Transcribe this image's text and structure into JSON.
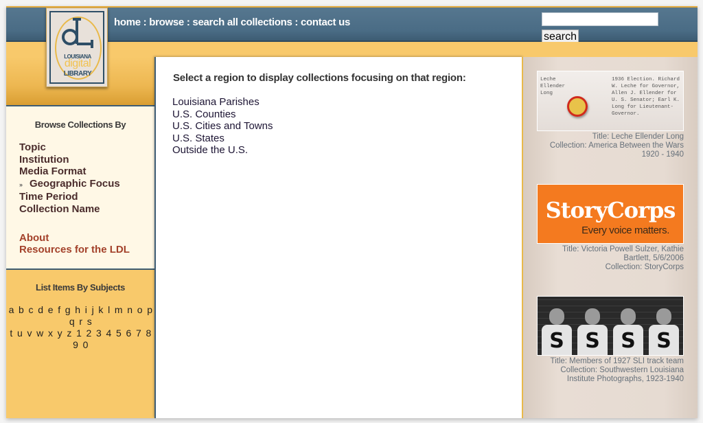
{
  "header": {
    "nav": [
      {
        "label": "home"
      },
      {
        "label": "browse"
      },
      {
        "label": "search all collections"
      },
      {
        "label": "contact us"
      }
    ],
    "separator": " : ",
    "search": {
      "value": "",
      "placeholder": "",
      "button_label": "search"
    }
  },
  "logo": {
    "line1": "LOUISIANA",
    "line2": "digital",
    "line3": "LIBRARY",
    "colors": {
      "navy": "#2e4e66",
      "gold": "#f2c24f"
    }
  },
  "sidebar": {
    "browse_heading": "Browse Collections By",
    "browse_items": [
      {
        "label": "Topic",
        "active": false
      },
      {
        "label": "Institution",
        "active": false
      },
      {
        "label": "Media Format",
        "active": false
      },
      {
        "label": "Geographic Focus",
        "active": true
      },
      {
        "label": "Time Period",
        "active": false
      },
      {
        "label": "Collection Name",
        "active": false
      }
    ],
    "active_marker": "»",
    "links": [
      {
        "label": "About"
      },
      {
        "label": "Resources for the LDL"
      }
    ],
    "subjects_heading": "List Items By Subjects",
    "subject_keys_row1": [
      "a",
      "b",
      "c",
      "d",
      "e",
      "f",
      "g",
      "h",
      "i",
      "j",
      "k",
      "l",
      "m",
      "n",
      "o",
      "p",
      "q",
      "r",
      "s"
    ],
    "subject_keys_row2": [
      "t",
      "u",
      "v",
      "w",
      "x",
      "y",
      "z",
      "1",
      "2",
      "3",
      "4",
      "5",
      "6",
      "7",
      "8",
      "9",
      "0"
    ]
  },
  "main": {
    "heading": "Select a region to display collections focusing on that region:",
    "regions": [
      {
        "label": "Louisiana Parishes"
      },
      {
        "label": "U.S. Counties"
      },
      {
        "label": "U.S. Cities and Towns"
      },
      {
        "label": "U.S. States"
      },
      {
        "label": "Outside the U.S."
      }
    ]
  },
  "featured": [
    {
      "image_text_left": [
        "Leche",
        "Ellender",
        "Long"
      ],
      "image_text_right": [
        "1936 Election. Richard",
        "W. Leche for Governor,",
        "Allen J. Ellender for",
        "U. S. Senator; Earl K.",
        "Long for Lieutenant-",
        "Governor."
      ],
      "title": "Title: Leche Ellender Long",
      "collection_lines": [
        "Collection: America Between the Wars",
        "1920 - 1940"
      ]
    },
    {
      "image_brand": "StoryCorps",
      "image_tagline": "Every voice matters.",
      "title_lines": [
        "Title: Victoria Powell Sulzer, Kathie",
        "Bartlett, 5/6/2006"
      ],
      "collection": "Collection: StoryCorps"
    },
    {
      "image_letter": "S",
      "title": "Title: Members of 1927 SLI track team",
      "collection_lines": [
        "Collection: Southwestern Louisiana",
        "Institute Photographs, 1923-1940"
      ]
    }
  ],
  "colors": {
    "topbar": "#4a6c85",
    "gold": "#f8c96b",
    "cream": "#fff8e6",
    "link_red": "#a3412a",
    "storycorps_orange": "#f47a1f"
  }
}
